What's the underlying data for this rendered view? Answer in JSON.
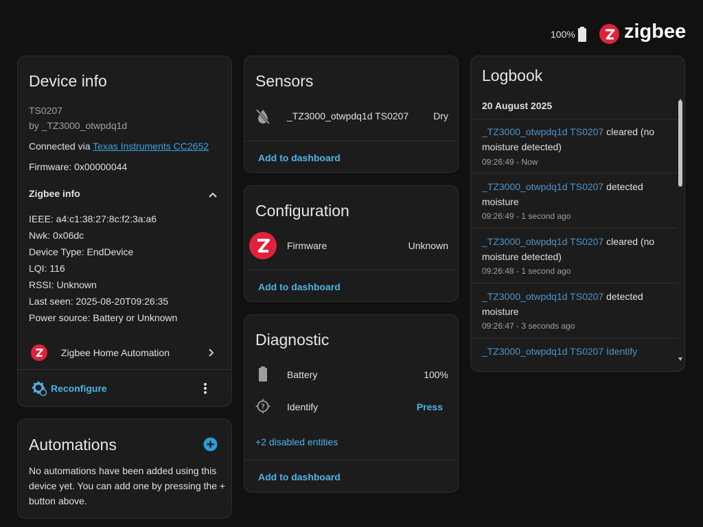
{
  "header": {
    "battery_percent": "100%",
    "brand": "zigbee",
    "brand_color": "#e0223b"
  },
  "device_info": {
    "title": "Device info",
    "model": "TS0207",
    "manufacturer": "by _TZ3000_otwpdq1d",
    "connected_prefix": "Connected via",
    "connected_link": "Texas Instruments CC2652",
    "firmware": "Firmware: 0x00000044",
    "zigbee_info_label": "Zigbee info",
    "zigbee_rows": [
      "IEEE: a4:c1:38:27:8c:f2:3a:a6",
      "Nwk: 0x06dc",
      "Device Type: EndDevice",
      "LQI: 116",
      "RSSI: Unknown",
      "Last seen: 2025-08-20T09:26:35",
      "Power source: Battery or Unknown"
    ],
    "integration": "Zigbee Home Automation",
    "reconfigure": "Reconfigure"
  },
  "automations": {
    "title": "Automations",
    "line1": "No automations have been added using this",
    "line2": "device yet. You can add one by pressing the +",
    "line3": "button above."
  },
  "sensors": {
    "title": "Sensors",
    "entity_name": "_TZ3000_otwpdq1d TS0207",
    "entity_state": "Dry",
    "add_to_dashboard": "Add to dashboard"
  },
  "configuration": {
    "title": "Configuration",
    "entity_name": "Firmware",
    "entity_state": "Unknown",
    "add_to_dashboard": "Add to dashboard"
  },
  "diagnostic": {
    "title": "Diagnostic",
    "battery_label": "Battery",
    "battery_value": "100%",
    "identify_label": "Identify",
    "identify_action": "Press",
    "disabled_entities": "+2 disabled entities",
    "add_to_dashboard": "Add to dashboard"
  },
  "logbook": {
    "title": "Logbook",
    "date": "20 August 2025",
    "entries": [
      {
        "entity": "_TZ3000_otwpdq1d TS0207",
        "line1_rest": " cleared (no",
        "line2": "moisture detected)",
        "time": "09:26:49 - Now"
      },
      {
        "entity": "_TZ3000_otwpdq1d TS0207",
        "line1_rest": " detected",
        "line2": "moisture",
        "time": "09:26:49 - 1 second ago"
      },
      {
        "entity": "_TZ3000_otwpdq1d TS0207",
        "line1_rest": " cleared (no",
        "line2": "moisture detected)",
        "time": "09:26:48 - 1 second ago"
      },
      {
        "entity": "_TZ3000_otwpdq1d TS0207",
        "line1_rest": " detected",
        "line2": "moisture",
        "time": "09:26:47 - 3 seconds ago"
      },
      {
        "entity": "_TZ3000_otwpdq1d TS0207",
        "line1_rest": " Identify"
      }
    ]
  },
  "colors": {
    "accent": "#4fb3e6",
    "background": "#111111",
    "card": "#1c1c1c",
    "zigbee_red": "#e0223b"
  }
}
